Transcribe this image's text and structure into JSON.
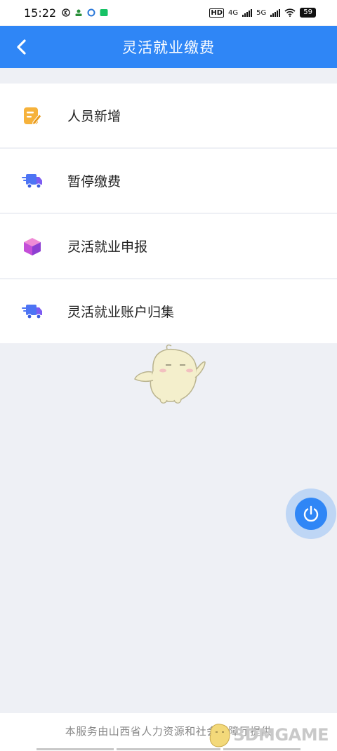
{
  "status_bar": {
    "time": "15:22",
    "network_labels": [
      "HD",
      "4G",
      "5G"
    ],
    "battery": "59"
  },
  "header": {
    "title": "灵活就业缴费"
  },
  "menu": {
    "items": [
      {
        "label": "人员新增",
        "icon": "edit-note-icon",
        "color": "#f6b23b"
      },
      {
        "label": "暂停缴费",
        "icon": "delivery-truck-icon",
        "color": "#4d74f4"
      },
      {
        "label": "灵活就业申报",
        "icon": "box-icon",
        "color": "#c44fd8"
      },
      {
        "label": "灵活就业账户归集",
        "icon": "delivery-truck-icon",
        "color": "#4d74f4"
      }
    ]
  },
  "footer": {
    "text": "本服务由山西省人力资源和社会保障厅提供"
  },
  "watermark": {
    "text": "3DMGAME"
  },
  "colors": {
    "primary": "#2f86f6",
    "background": "#eef0f5"
  }
}
